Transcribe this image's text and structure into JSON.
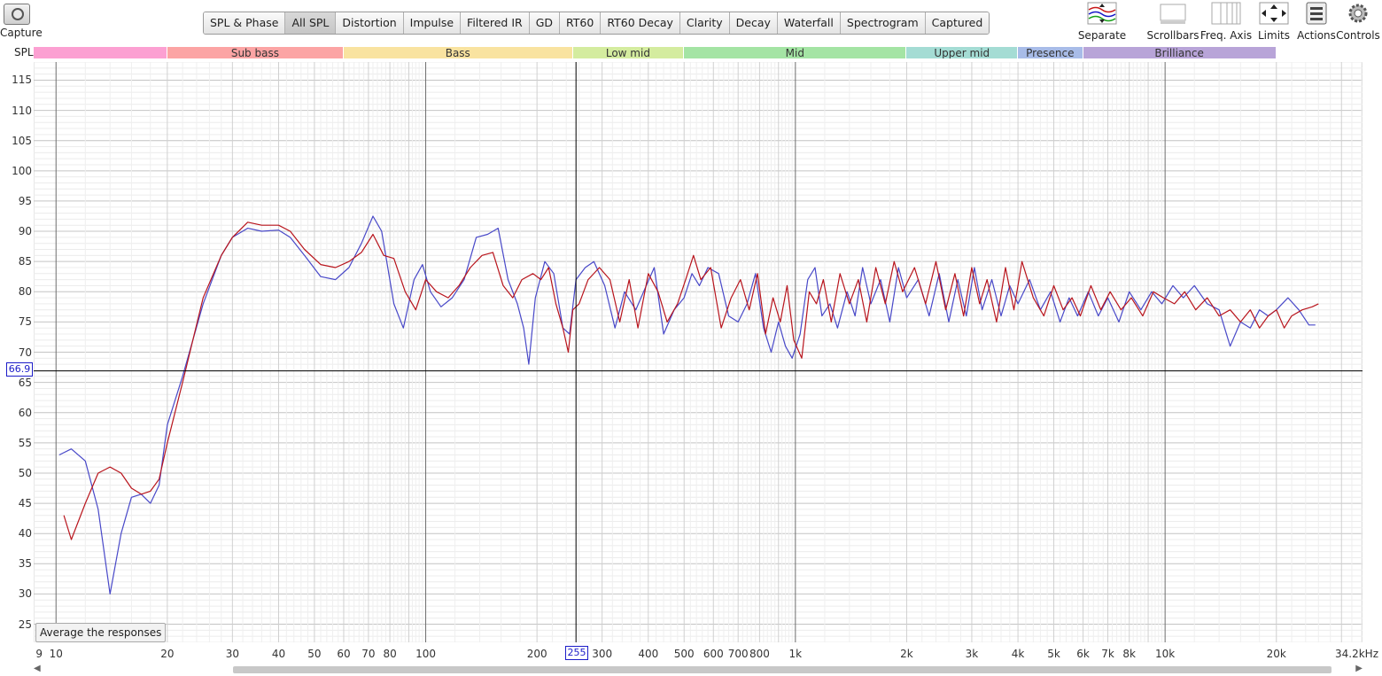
{
  "capture": {
    "label": "Capture"
  },
  "tabs": [
    {
      "label": "SPL & Phase",
      "active": false
    },
    {
      "label": "All SPL",
      "active": true
    },
    {
      "label": "Distortion",
      "active": false
    },
    {
      "label": "Impulse",
      "active": false
    },
    {
      "label": "Filtered IR",
      "active": false
    },
    {
      "label": "GD",
      "active": false
    },
    {
      "label": "RT60",
      "active": false
    },
    {
      "label": "RT60 Decay",
      "active": false
    },
    {
      "label": "Clarity",
      "active": false
    },
    {
      "label": "Decay",
      "active": false
    },
    {
      "label": "Waterfall",
      "active": false
    },
    {
      "label": "Spectrogram",
      "active": false
    },
    {
      "label": "Captured",
      "active": false
    }
  ],
  "tools": {
    "separate": "Separate",
    "scrollbars": "Scrollbars",
    "freq_axis": "Freq. Axis",
    "limits": "Limits",
    "actions": "Actions",
    "controls": "Controls"
  },
  "spl_label": "SPL",
  "bands": [
    {
      "label": "",
      "from": 8.7,
      "to": 20,
      "color": "#fca0d2"
    },
    {
      "label": "Sub bass",
      "from": 20,
      "to": 60,
      "color": "#fca4a4"
    },
    {
      "label": "Bass",
      "from": 60,
      "to": 250,
      "color": "#f9e3a0"
    },
    {
      "label": "Low mid",
      "from": 250,
      "to": 500,
      "color": "#d4ec9f"
    },
    {
      "label": "Mid",
      "from": 500,
      "to": 2000,
      "color": "#a4e4a4"
    },
    {
      "label": "Upper mid",
      "from": 2000,
      "to": 4000,
      "color": "#a4dcd4"
    },
    {
      "label": "Presence",
      "from": 4000,
      "to": 6000,
      "color": "#a8bce8"
    },
    {
      "label": "Brilliance",
      "from": 6000,
      "to": 20000,
      "color": "#b8a4d8"
    }
  ],
  "cursor": {
    "y_value": "66.9",
    "x_value": "255"
  },
  "average_button": "Average the responses",
  "chart_data": {
    "type": "line",
    "xlabel": "",
    "ylabel": "SPL",
    "x_scale": "log",
    "xlim": [
      8.7,
      34200
    ],
    "ylim": [
      22,
      118
    ],
    "y_ticks": [
      25,
      30,
      35,
      40,
      45,
      50,
      55,
      60,
      65,
      70,
      75,
      80,
      85,
      90,
      95,
      100,
      105,
      110,
      115
    ],
    "x_tick_labels": [
      {
        "v": 9,
        "t": "9"
      },
      {
        "v": 10,
        "t": "10"
      },
      {
        "v": 20,
        "t": "20"
      },
      {
        "v": 30,
        "t": "30"
      },
      {
        "v": 40,
        "t": "40"
      },
      {
        "v": 50,
        "t": "50"
      },
      {
        "v": 60,
        "t": "60"
      },
      {
        "v": 70,
        "t": "70"
      },
      {
        "v": 80,
        "t": "80"
      },
      {
        "v": 100,
        "t": "100"
      },
      {
        "v": 200,
        "t": "200"
      },
      {
        "v": 300,
        "t": "300"
      },
      {
        "v": 400,
        "t": "400"
      },
      {
        "v": 500,
        "t": "500"
      },
      {
        "v": 600,
        "t": "600"
      },
      {
        "v": 700,
        "t": "700"
      },
      {
        "v": 800,
        "t": "800"
      },
      {
        "v": 1000,
        "t": "1k"
      },
      {
        "v": 2000,
        "t": "2k"
      },
      {
        "v": 3000,
        "t": "3k"
      },
      {
        "v": 4000,
        "t": "4k"
      },
      {
        "v": 5000,
        "t": "5k"
      },
      {
        "v": 6000,
        "t": "6k"
      },
      {
        "v": 7000,
        "t": "7k"
      },
      {
        "v": 8000,
        "t": "8k"
      },
      {
        "v": 10000,
        "t": "10k"
      },
      {
        "v": 20000,
        "t": "20k"
      },
      {
        "v": 34200,
        "t": "34.2kHz"
      }
    ],
    "cursor": {
      "x": 255,
      "y": 66.9
    },
    "series": [
      {
        "color": "#4848c8",
        "points": [
          [
            10.2,
            53
          ],
          [
            11,
            54
          ],
          [
            12,
            52
          ],
          [
            13,
            44
          ],
          [
            14,
            30
          ],
          [
            15,
            40
          ],
          [
            16,
            46
          ],
          [
            17,
            46.5
          ],
          [
            18,
            45
          ],
          [
            19,
            48
          ],
          [
            20,
            58
          ],
          [
            22,
            66
          ],
          [
            25,
            78
          ],
          [
            28,
            86
          ],
          [
            30,
            89
          ],
          [
            33,
            90.5
          ],
          [
            36,
            90
          ],
          [
            40,
            90.2
          ],
          [
            43,
            89
          ],
          [
            47,
            86
          ],
          [
            52,
            82.5
          ],
          [
            57,
            82
          ],
          [
            62,
            84
          ],
          [
            67,
            88
          ],
          [
            72,
            92.5
          ],
          [
            76,
            90
          ],
          [
            82,
            78
          ],
          [
            87,
            74
          ],
          [
            93,
            82
          ],
          [
            98,
            84.5
          ],
          [
            103,
            80
          ],
          [
            110,
            77.5
          ],
          [
            118,
            79
          ],
          [
            127,
            82
          ],
          [
            137,
            89
          ],
          [
            147,
            89.5
          ],
          [
            157,
            90.5
          ],
          [
            167,
            82
          ],
          [
            177,
            78
          ],
          [
            184,
            74
          ],
          [
            190,
            68
          ],
          [
            198,
            79
          ],
          [
            210,
            85
          ],
          [
            222,
            83
          ],
          [
            235,
            74
          ],
          [
            245,
            73
          ],
          [
            255,
            82
          ],
          [
            270,
            84
          ],
          [
            285,
            85
          ],
          [
            305,
            81
          ],
          [
            325,
            74
          ],
          [
            345,
            80
          ],
          [
            370,
            77
          ],
          [
            395,
            81
          ],
          [
            415,
            84
          ],
          [
            440,
            73
          ],
          [
            470,
            77
          ],
          [
            500,
            79
          ],
          [
            525,
            83
          ],
          [
            550,
            81
          ],
          [
            580,
            84
          ],
          [
            620,
            83
          ],
          [
            660,
            76
          ],
          [
            700,
            75
          ],
          [
            740,
            78
          ],
          [
            780,
            83
          ],
          [
            820,
            74
          ],
          [
            860,
            70
          ],
          [
            900,
            75
          ],
          [
            940,
            71
          ],
          [
            980,
            69
          ],
          [
            1030,
            73
          ],
          [
            1080,
            82
          ],
          [
            1130,
            84
          ],
          [
            1180,
            76
          ],
          [
            1240,
            78
          ],
          [
            1300,
            74
          ],
          [
            1380,
            80
          ],
          [
            1450,
            76
          ],
          [
            1520,
            84
          ],
          [
            1600,
            78
          ],
          [
            1700,
            82
          ],
          [
            1800,
            75
          ],
          [
            1900,
            84
          ],
          [
            2000,
            79
          ],
          [
            2150,
            82
          ],
          [
            2300,
            76
          ],
          [
            2450,
            83
          ],
          [
            2600,
            75
          ],
          [
            2750,
            82
          ],
          [
            2900,
            76
          ],
          [
            3050,
            84
          ],
          [
            3200,
            77
          ],
          [
            3400,
            82
          ],
          [
            3600,
            76
          ],
          [
            3800,
            81
          ],
          [
            4000,
            78
          ],
          [
            4300,
            82
          ],
          [
            4600,
            77
          ],
          [
            4900,
            80
          ],
          [
            5200,
            75
          ],
          [
            5500,
            79
          ],
          [
            5800,
            76
          ],
          [
            6200,
            80
          ],
          [
            6600,
            76
          ],
          [
            7000,
            79
          ],
          [
            7500,
            75
          ],
          [
            8000,
            80
          ],
          [
            8600,
            77
          ],
          [
            9200,
            80
          ],
          [
            9800,
            78
          ],
          [
            10500,
            81
          ],
          [
            11200,
            79
          ],
          [
            12000,
            81
          ],
          [
            13000,
            78
          ],
          [
            14000,
            77
          ],
          [
            15000,
            71
          ],
          [
            16000,
            75
          ],
          [
            17000,
            74
          ],
          [
            18000,
            77
          ],
          [
            19000,
            76
          ],
          [
            20000,
            77
          ],
          [
            21500,
            79
          ],
          [
            23000,
            77
          ],
          [
            24500,
            74.5
          ],
          [
            25500,
            74.5
          ]
        ]
      },
      {
        "color": "#b8141c",
        "points": [
          [
            10.5,
            43
          ],
          [
            11,
            39
          ],
          [
            12,
            45
          ],
          [
            13,
            50
          ],
          [
            14,
            51
          ],
          [
            15,
            50
          ],
          [
            16,
            47.5
          ],
          [
            17,
            46.5
          ],
          [
            18,
            47
          ],
          [
            19,
            49
          ],
          [
            20,
            55
          ],
          [
            22,
            65
          ],
          [
            25,
            79
          ],
          [
            28,
            86
          ],
          [
            30,
            89
          ],
          [
            33,
            91.5
          ],
          [
            36,
            91
          ],
          [
            40,
            91
          ],
          [
            43,
            90
          ],
          [
            47,
            87
          ],
          [
            52,
            84.5
          ],
          [
            57,
            84
          ],
          [
            62,
            85
          ],
          [
            67,
            86.5
          ],
          [
            72,
            89.5
          ],
          [
            77,
            86
          ],
          [
            82,
            85.5
          ],
          [
            88,
            80
          ],
          [
            94,
            77
          ],
          [
            100,
            82
          ],
          [
            107,
            80
          ],
          [
            115,
            79
          ],
          [
            123,
            81
          ],
          [
            132,
            84
          ],
          [
            142,
            86
          ],
          [
            152,
            86.5
          ],
          [
            162,
            81
          ],
          [
            172,
            79
          ],
          [
            182,
            82
          ],
          [
            195,
            83
          ],
          [
            205,
            82
          ],
          [
            215,
            84
          ],
          [
            225,
            78
          ],
          [
            235,
            74
          ],
          [
            243,
            70
          ],
          [
            250,
            77
          ],
          [
            260,
            78
          ],
          [
            275,
            82
          ],
          [
            295,
            84
          ],
          [
            315,
            82
          ],
          [
            335,
            75
          ],
          [
            355,
            82
          ],
          [
            375,
            74
          ],
          [
            400,
            83
          ],
          [
            425,
            80
          ],
          [
            450,
            75
          ],
          [
            480,
            78
          ],
          [
            505,
            82
          ],
          [
            530,
            86
          ],
          [
            555,
            82
          ],
          [
            590,
            84
          ],
          [
            630,
            74
          ],
          [
            670,
            79
          ],
          [
            710,
            82
          ],
          [
            750,
            77
          ],
          [
            790,
            83
          ],
          [
            830,
            73
          ],
          [
            870,
            79
          ],
          [
            910,
            75
          ],
          [
            950,
            81
          ],
          [
            990,
            72
          ],
          [
            1040,
            69
          ],
          [
            1090,
            80
          ],
          [
            1140,
            78
          ],
          [
            1190,
            82
          ],
          [
            1250,
            75
          ],
          [
            1320,
            83
          ],
          [
            1400,
            78
          ],
          [
            1480,
            82
          ],
          [
            1560,
            75
          ],
          [
            1650,
            84
          ],
          [
            1750,
            78
          ],
          [
            1850,
            85
          ],
          [
            1950,
            80
          ],
          [
            2100,
            84
          ],
          [
            2250,
            78
          ],
          [
            2400,
            85
          ],
          [
            2550,
            77
          ],
          [
            2700,
            83
          ],
          [
            2850,
            76
          ],
          [
            3000,
            84
          ],
          [
            3150,
            78
          ],
          [
            3300,
            82
          ],
          [
            3500,
            75
          ],
          [
            3700,
            84
          ],
          [
            3900,
            77
          ],
          [
            4100,
            85
          ],
          [
            4400,
            79
          ],
          [
            4700,
            76
          ],
          [
            5000,
            81
          ],
          [
            5300,
            77
          ],
          [
            5600,
            79
          ],
          [
            5900,
            76
          ],
          [
            6300,
            81
          ],
          [
            6700,
            77
          ],
          [
            7100,
            80
          ],
          [
            7600,
            77
          ],
          [
            8100,
            79
          ],
          [
            8700,
            76
          ],
          [
            9300,
            80
          ],
          [
            9900,
            79
          ],
          [
            10600,
            78
          ],
          [
            11300,
            80
          ],
          [
            12100,
            77
          ],
          [
            13000,
            79
          ],
          [
            14000,
            76
          ],
          [
            15000,
            77
          ],
          [
            16000,
            75
          ],
          [
            17000,
            77
          ],
          [
            18000,
            74
          ],
          [
            19000,
            76
          ],
          [
            20000,
            77
          ],
          [
            21000,
            74
          ],
          [
            22000,
            76
          ],
          [
            23500,
            77
          ],
          [
            25000,
            77.5
          ],
          [
            26000,
            78
          ]
        ]
      }
    ]
  }
}
